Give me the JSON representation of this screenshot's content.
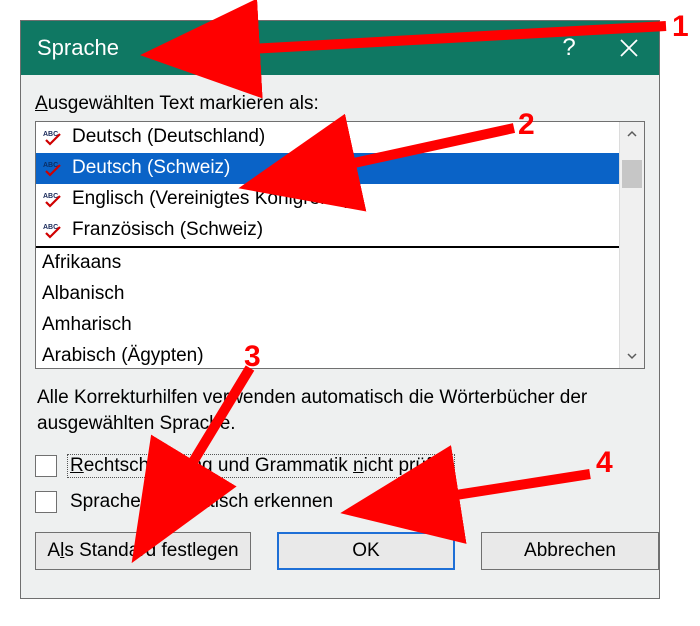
{
  "titlebar": {
    "title": "Sprache",
    "help_symbol": "?",
    "close_label": "Close"
  },
  "body": {
    "top_label_pre": "A",
    "top_label_rest": "usgewählten Text markieren als:",
    "languages_top": [
      {
        "name": "Deutsch (Deutschland)",
        "spellcheck": true
      },
      {
        "name": "Deutsch (Schweiz)",
        "spellcheck": true,
        "selected": true
      },
      {
        "name": "Englisch (Vereinigtes Königreich)",
        "spellcheck": true
      },
      {
        "name": "Französisch (Schweiz)",
        "spellcheck": true
      }
    ],
    "languages_rest": [
      {
        "name": "Afrikaans"
      },
      {
        "name": "Albanisch"
      },
      {
        "name": "Amharisch"
      },
      {
        "name": "Arabisch (Ägypten)"
      }
    ],
    "info_text": "Alle Korrekturhilfen verwenden automatisch die Wörterbücher der ausgewählten Sprache.",
    "check1_a": "R",
    "check1_b": "echtschreibung und Grammatik ",
    "check1_c": "n",
    "check1_d": "icht prüfen",
    "check2_a": "Sprache a",
    "check2_b": "u",
    "check2_c": "tomatisch erkennen",
    "btn_default_a": "A",
    "btn_default_b": "l",
    "btn_default_c": "s Standard festlegen",
    "btn_ok": "OK",
    "btn_cancel": "Abbrechen"
  },
  "annotations": {
    "n1": "1",
    "n2": "2",
    "n3": "3",
    "n4": "4"
  }
}
